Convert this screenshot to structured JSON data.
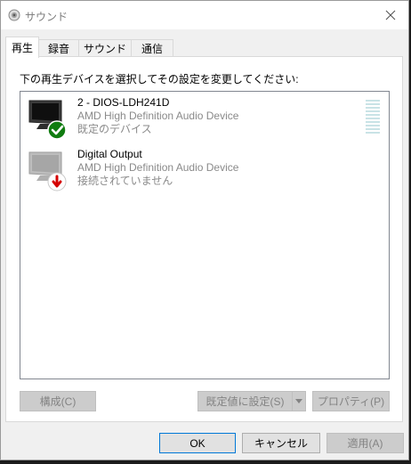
{
  "window": {
    "title": "サウンド",
    "close_icon": "close-icon"
  },
  "tabs": [
    {
      "label": "再生",
      "active": true
    },
    {
      "label": "録音",
      "active": false
    },
    {
      "label": "サウンド",
      "active": false
    },
    {
      "label": "通信",
      "active": false
    }
  ],
  "playback": {
    "instruction": "下の再生デバイスを選択してその設定を変更してください:",
    "devices": [
      {
        "name": "2 - DIOS-LDH241D",
        "driver": "AMD High Definition Audio Device",
        "status": "既定のデバイス",
        "icon": "monitor-default-icon",
        "status_icon": "check-icon",
        "status_color": "#107c10",
        "level": 0
      },
      {
        "name": "Digital Output",
        "driver": "AMD High Definition Audio Device",
        "status": "接続されていません",
        "icon": "monitor-disconnected-icon",
        "status_icon": "down-arrow-icon",
        "status_color": "#d40000"
      }
    ],
    "buttons": {
      "configure": "構成(C)",
      "set_default": "既定値に設定(S)",
      "properties": "プロパティ(P)"
    }
  },
  "footer": {
    "ok": "OK",
    "cancel": "キャンセル",
    "apply": "適用(A)"
  }
}
